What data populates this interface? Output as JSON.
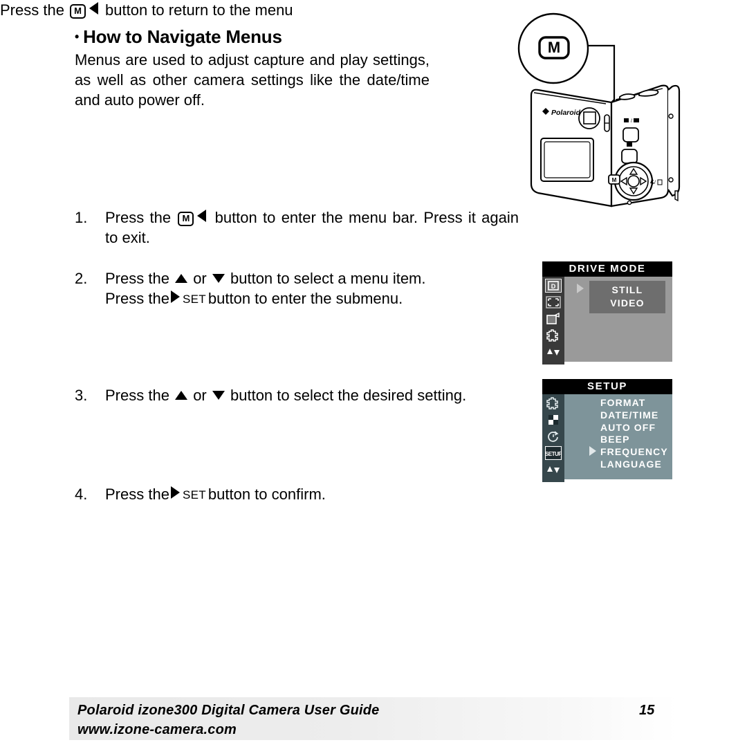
{
  "heading": {
    "bullet": "•",
    "text": "How to Navigate Menus"
  },
  "intro": {
    "paragraph": "Menus are used to adjust capture and play settings, as well as other camera settings like the date/time and auto power off."
  },
  "steps": [
    {
      "number": "1.",
      "text_before_m": "Press the",
      "text_after_arrow": "button to enter the menu bar. Press it again to exit.",
      "m_key": "M"
    },
    {
      "number": "2.",
      "line1_before": "Press the",
      "line1_mid": "or",
      "line1_after": "button to select a menu item.",
      "line2_before": "Press the",
      "line2_set": "SET",
      "line2_after": "button to enter the submenu."
    },
    {
      "number": "3.",
      "line1_before": "Press the",
      "line1_mid": "or",
      "line1_after": "button to select the desired setting."
    },
    {
      "number": "4.",
      "line1_before": "Press the",
      "line1_set": "SET",
      "line1_after": "button to confirm."
    }
  ],
  "step2_return": {
    "before": "Press the",
    "m_key": "M",
    "after": "button to return to the menu"
  },
  "callout": {
    "label": "M"
  },
  "camera": {
    "brand": "Polaroid"
  },
  "drive_mode_menu": {
    "title": "DRIVE MODE",
    "items": [
      "STILL",
      "VIDEO"
    ],
    "sidebar_icons": [
      "drive-mode-icon",
      "resolution-icon",
      "quality-icon",
      "effects-icon",
      "updown-icon"
    ],
    "selected_sidebar_index": 0,
    "cursor_target_index": 0,
    "colors": {
      "title_bar": "#000000",
      "background": "#9a9a9a",
      "sidebar": "#3a3a3a",
      "submenu": "#6e6e6e",
      "text": "#ffffff"
    }
  },
  "setup_menu": {
    "title": "SETUP",
    "items": [
      "FORMAT",
      "DATE/TIME",
      "AUTO OFF",
      "BEEP",
      "FREQUENCY",
      "LANGUAGE"
    ],
    "sidebar_icons": [
      "effects-icon",
      "checker-icon",
      "self-timer-icon",
      "setup-icon",
      "updown-icon"
    ],
    "selected_sidebar_index": 3,
    "cursor_item": "FREQUENCY",
    "colors": {
      "title_bar": "#000000",
      "background": "#7e949a",
      "sidebar": "#36474c",
      "text": "#ffffff"
    }
  },
  "footer": {
    "title": "Polaroid izone300 Digital Camera User Guide",
    "url": "www.izone-camera.com",
    "page_number": "15"
  }
}
